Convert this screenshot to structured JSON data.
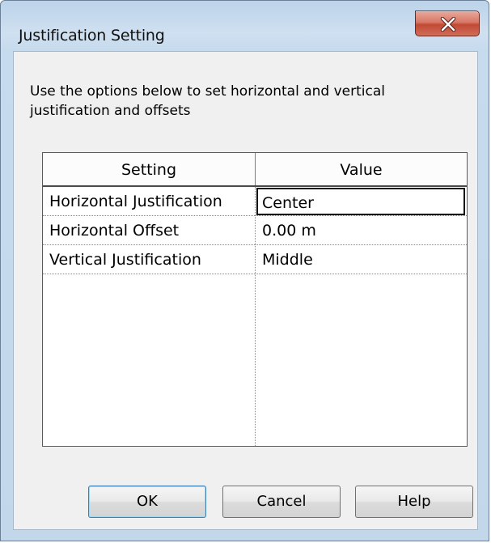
{
  "window": {
    "title": "Justification Setting"
  },
  "instruction": "Use the options below to set horizontal and vertical justification and offsets",
  "grid": {
    "columns": [
      "Setting",
      "Value"
    ],
    "rows": [
      {
        "setting": "Horizontal Justification",
        "value": "Center"
      },
      {
        "setting": "Horizontal Offset",
        "value": "0.00 m"
      },
      {
        "setting": "Vertical Justification",
        "value": "Middle"
      }
    ]
  },
  "buttons": {
    "ok": "OK",
    "cancel": "Cancel",
    "help": "Help"
  },
  "icons": {
    "close": "close-icon"
  },
  "colors": {
    "close_button": "#c94a36",
    "ok_border": "#3c7fb1"
  }
}
